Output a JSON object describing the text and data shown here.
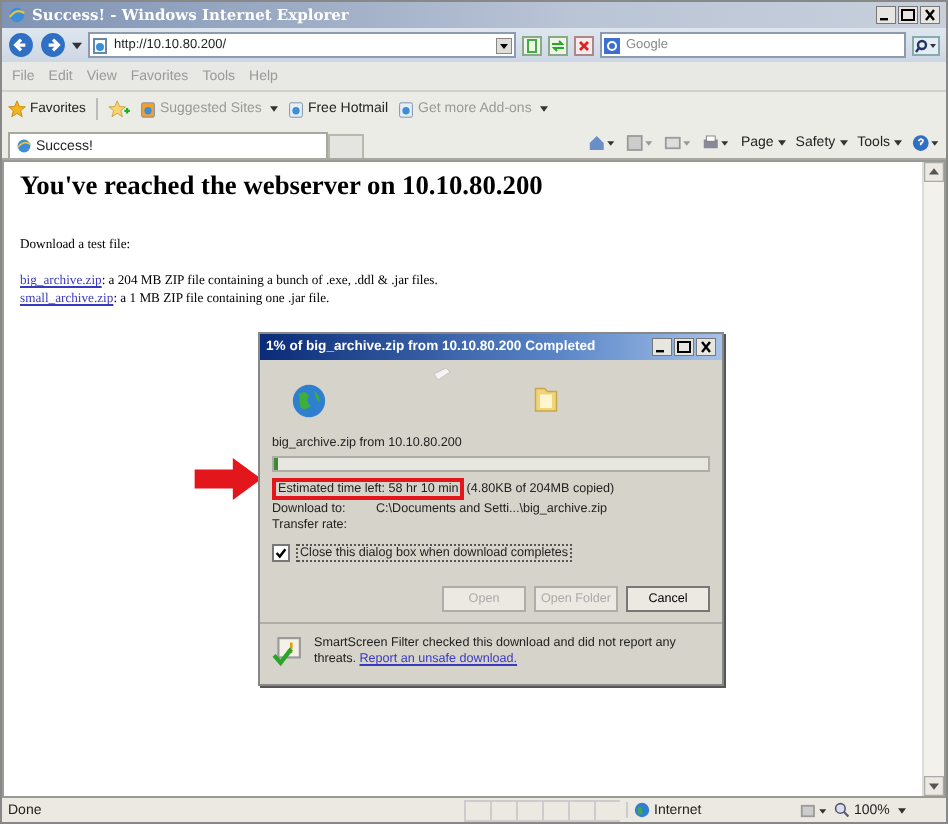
{
  "window": {
    "title": "Success! - Windows Internet Explorer"
  },
  "address_bar": {
    "value": "http://10.10.80.200/"
  },
  "search": {
    "placeholder": "Google"
  },
  "menu": [
    "File",
    "Edit",
    "View",
    "Favorites",
    "Tools",
    "Help"
  ],
  "favorites_bar": {
    "label": "Favorites",
    "items": [
      {
        "label": "Suggested Sites",
        "dimmed": true,
        "dropdown": true
      },
      {
        "label": "Free Hotmail",
        "dimmed": false,
        "dropdown": false
      },
      {
        "label": "Get more Add-ons",
        "dimmed": true,
        "dropdown": true
      }
    ]
  },
  "tabs": [
    {
      "label": "Success!",
      "selected": true
    }
  ],
  "command_bar": [
    "Page",
    "Safety",
    "Tools"
  ],
  "page": {
    "heading": "You've reached the webserver on 10.10.80.200",
    "intro": "Download a test file:",
    "downloads": [
      {
        "link": "big_archive.zip",
        "text": ": a 204 MB ZIP file containing a bunch of .exe, .ddl & .jar files."
      },
      {
        "link": "small_archive.zip",
        "text": ": a 1 MB ZIP file containing one .jar file."
      }
    ]
  },
  "dialog": {
    "title": "1% of big_archive.zip from 10.10.80.200 Completed",
    "source": "big_archive.zip from 10.10.80.200",
    "progress": {
      "level": 0.01
    },
    "estimate": {
      "text": "Estimated time left: 58 hr 10 min",
      "highlighted": true,
      "detail": "(4.80KB of 204MB copied)"
    },
    "rows": [
      {
        "label": "Download to:",
        "value": "C:\\Documents and Setti...\\big_archive.zip"
      },
      {
        "label": "Transfer rate:"
      }
    ],
    "close_when_done": {
      "label": "Close this dialog box when download completes",
      "checked": true
    },
    "buttons": [
      {
        "label": "Open",
        "disabled": true
      },
      {
        "label": "Open Folder",
        "disabled": true
      },
      {
        "label": "Cancel",
        "disabled": false
      }
    ],
    "smartscreen": {
      "text": "SmartScreen Filter checked this download and did not report any threats.",
      "link": "Report an unsafe download."
    }
  },
  "status_bar": {
    "status": "Done",
    "zone": "Internet",
    "zoom": "100%"
  }
}
